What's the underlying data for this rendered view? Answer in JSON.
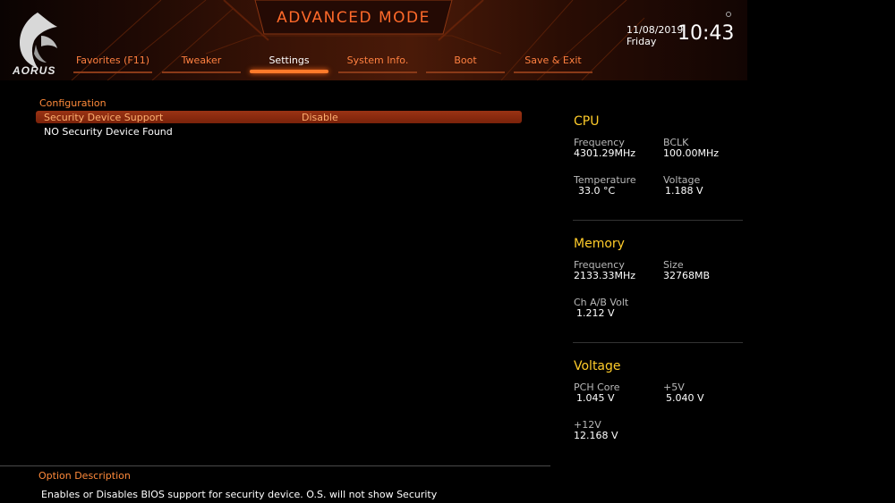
{
  "header": {
    "mode_title": "ADVANCED MODE",
    "logo_text": "AORUS",
    "date": "11/08/2019",
    "day": "Friday",
    "time": "10:43"
  },
  "tabs": [
    {
      "label": "Favorites (F11)",
      "active": false
    },
    {
      "label": "Tweaker",
      "active": false
    },
    {
      "label": "Settings",
      "active": true
    },
    {
      "label": "System Info.",
      "active": false
    },
    {
      "label": "Boot",
      "active": false
    },
    {
      "label": "Save & Exit",
      "active": false
    }
  ],
  "main": {
    "section_title": "Configuration",
    "selected_row": {
      "label": "Security Device Support",
      "value": "Disable"
    },
    "info_line": "NO Security Device Found"
  },
  "panel": {
    "cpu": {
      "title": "CPU",
      "frequency_label": "Frequency",
      "frequency_value": "4301.29MHz",
      "bclk_label": "BCLK",
      "bclk_value": "100.00MHz",
      "temperature_label": "Temperature",
      "temperature_value": "33.0 °C",
      "voltage_label": "Voltage",
      "voltage_value": "1.188 V"
    },
    "memory": {
      "title": "Memory",
      "frequency_label": "Frequency",
      "frequency_value": "2133.33MHz",
      "size_label": "Size",
      "size_value": "32768MB",
      "chab_label": "Ch A/B Volt",
      "chab_value": "1.212 V"
    },
    "voltage": {
      "title": "Voltage",
      "pch_label": "PCH Core",
      "pch_value": "1.045 V",
      "p5v_label": "+5V",
      "p5v_value": "5.040 V",
      "p12v_label": "+12V",
      "p12v_value": "12.168 V"
    }
  },
  "bottom": {
    "desc_title": "Option Description",
    "desc_text": "Enables or Disables BIOS support for security device. O.S. will not show Security"
  },
  "colors": {
    "accent_orange": "#ff7a2a",
    "group_title_yellow": "#ffcc2a",
    "highlight_row": "#8a2a0e"
  }
}
